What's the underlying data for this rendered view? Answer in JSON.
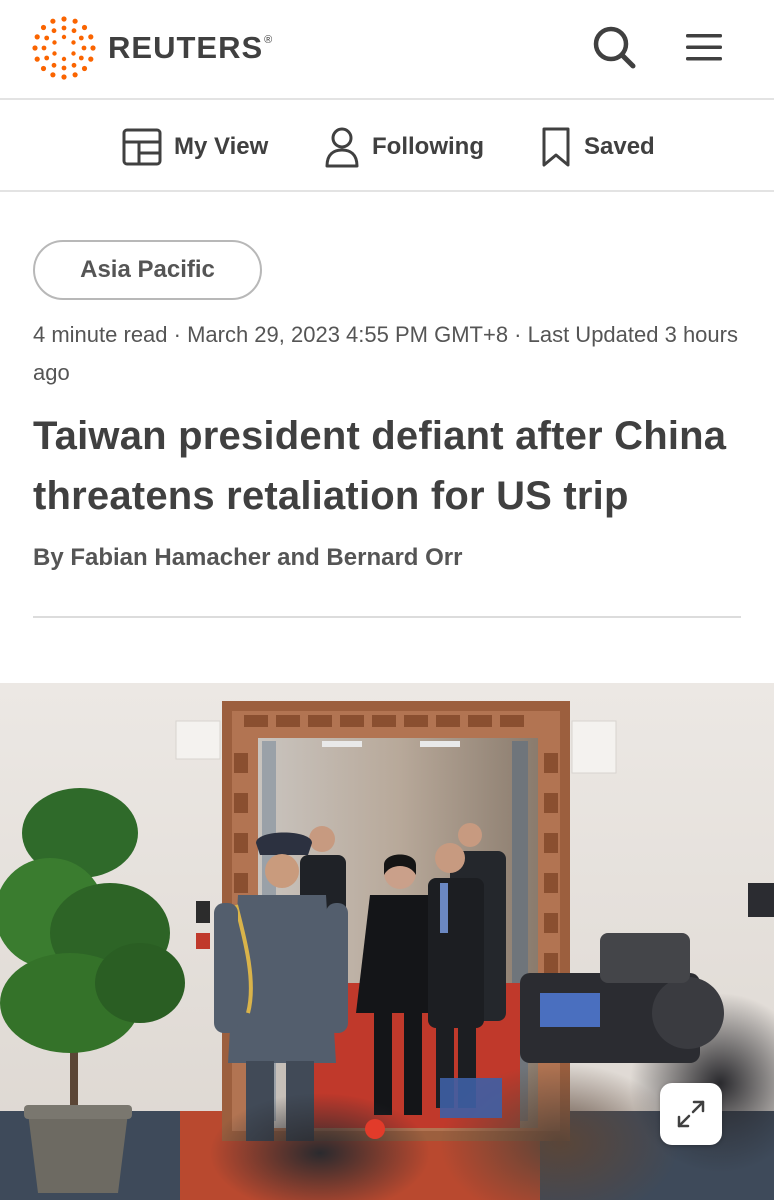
{
  "brand": {
    "name": "REUTERS",
    "registered": "®",
    "accent": "#fa6400"
  },
  "header": {
    "search_icon": "search-icon",
    "menu_icon": "hamburger-menu-icon"
  },
  "subnav": {
    "items": [
      {
        "label": "My View",
        "icon": "layout-icon"
      },
      {
        "label": "Following",
        "icon": "person-icon"
      },
      {
        "label": "Saved",
        "icon": "bookmark-icon"
      }
    ]
  },
  "article": {
    "section_tag": "Asia Pacific",
    "meta": "4 minute read · March 29, 2023 4:55 PM GMT+8 · Last Updated 3 hours ago",
    "headline": "Taiwan president defiant after China threatens retaliation for US trip",
    "byline": "By Fabian Hamacher and Bernard Orr"
  },
  "photo": {
    "expand_icon": "expand-icon"
  }
}
